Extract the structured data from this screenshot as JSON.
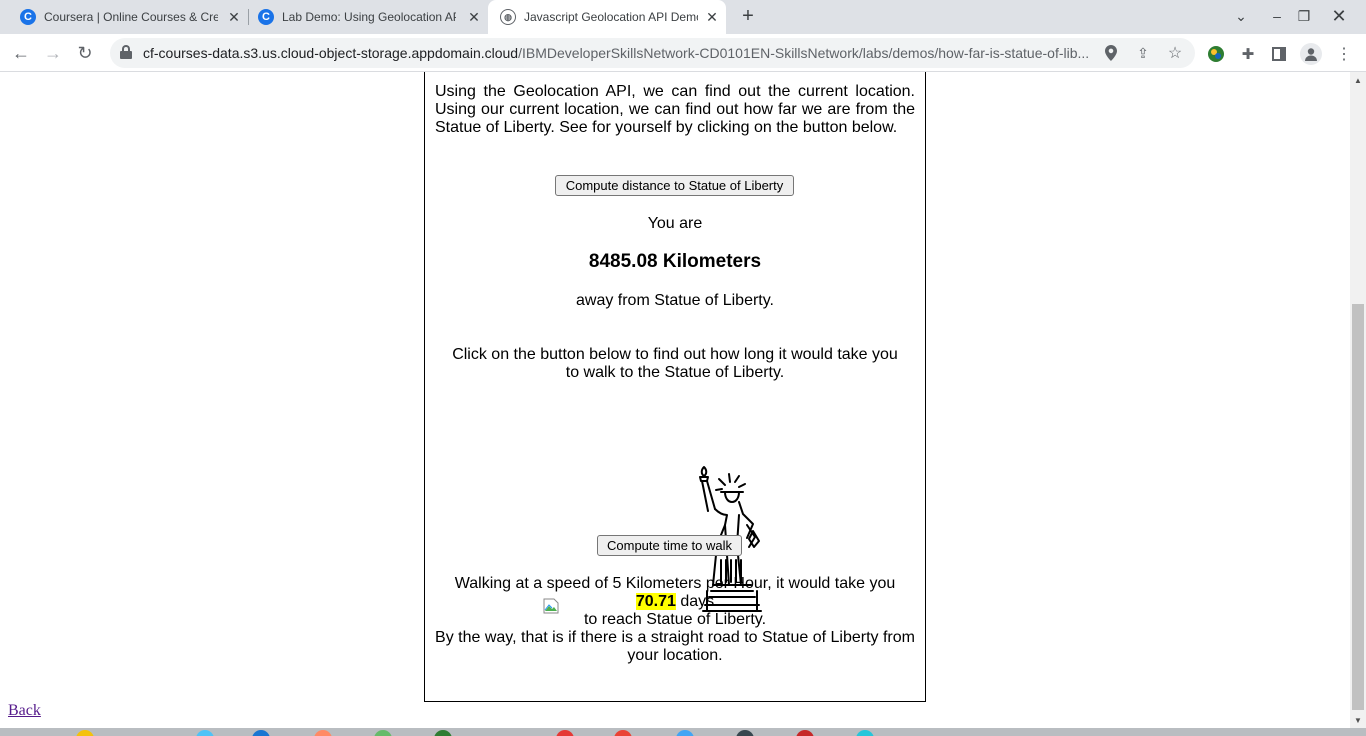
{
  "browser": {
    "tabs": [
      {
        "title": "Coursera | Online Courses & Credentials",
        "favicon": "coursera-icon",
        "active": false
      },
      {
        "title": "Lab Demo: Using Geolocation API",
        "favicon": "coursera-icon",
        "active": false
      },
      {
        "title": "Javascript Geolocation API Demo",
        "favicon": "globe-icon",
        "active": true
      }
    ],
    "new_tab_symbol": "+",
    "url_host": "cf-courses-data.s3.us.cloud-object-storage.appdomain.cloud",
    "url_path": "/IBMDeveloperSkillsNetwork-CD0101EN-SkillsNetwork/labs/demos/how-far-is-statue-of-lib...",
    "accent_color": "#1a73e8"
  },
  "page": {
    "intro": "Using the Geolocation API, we can find out the current location. Using our current location, we can find out how far we are from the Statue of Liberty. See for yourself by clicking on the button below.",
    "compute_distance_label": "Compute distance to Statue of Liberty",
    "you_are": "You are",
    "distance": "8485.08 Kilometers",
    "away_from": "away from Statue of Liberty.",
    "walk_prompt": "Click on the button below to find out how long it would take you to walk to the Statue of Liberty.",
    "compute_time_label": "Compute time to walk",
    "walk_speed_text": "Walking at a speed of 5 Kilometers per Hour, it would take you",
    "days_value": "70.71",
    "days_unit": "days",
    "reach_text": "to reach Statue of Liberty.",
    "by_the_way": "By the way, that is if there is a straight road to Statue of Liberty from your location.",
    "back_link": "Back",
    "highlight_color": "#ffff00"
  }
}
